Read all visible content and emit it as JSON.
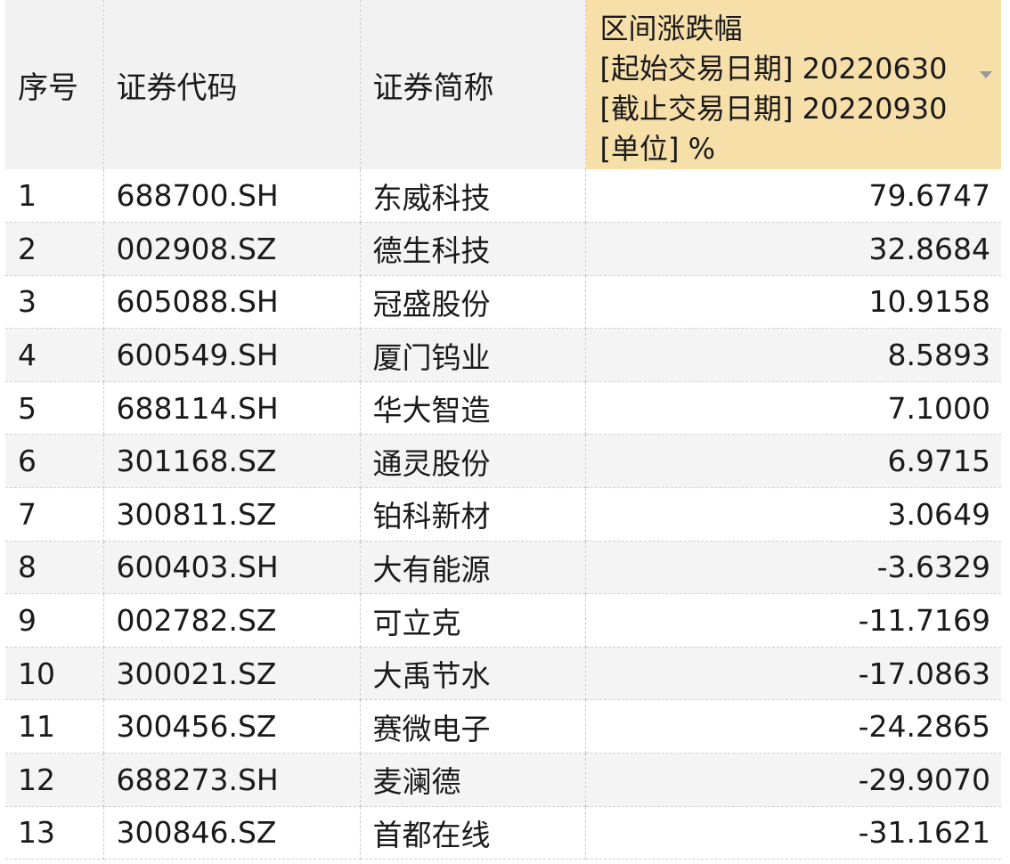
{
  "table": {
    "headers": {
      "seq": "序号",
      "code": "证券代码",
      "name": "证券简称",
      "change_lines": [
        "区间涨跌幅",
        "[起始交易日期] 20220630",
        "[截止交易日期] 20220930",
        "[单位] %"
      ]
    },
    "rows": [
      {
        "seq": "1",
        "code": "688700.SH",
        "name": "东威科技",
        "change": "79.6747"
      },
      {
        "seq": "2",
        "code": "002908.SZ",
        "name": "德生科技",
        "change": "32.8684"
      },
      {
        "seq": "3",
        "code": "605088.SH",
        "name": "冠盛股份",
        "change": "10.9158"
      },
      {
        "seq": "4",
        "code": "600549.SH",
        "name": "厦门钨业",
        "change": "8.5893"
      },
      {
        "seq": "5",
        "code": "688114.SH",
        "name": "华大智造",
        "change": "7.1000"
      },
      {
        "seq": "6",
        "code": "301168.SZ",
        "name": "通灵股份",
        "change": "6.9715"
      },
      {
        "seq": "7",
        "code": "300811.SZ",
        "name": "铂科新材",
        "change": "3.0649"
      },
      {
        "seq": "8",
        "code": "600403.SH",
        "name": "大有能源",
        "change": "-3.6329"
      },
      {
        "seq": "9",
        "code": "002782.SZ",
        "name": "可立克",
        "change": "-11.7169"
      },
      {
        "seq": "10",
        "code": "300021.SZ",
        "name": "大禹节水",
        "change": "-17.0863"
      },
      {
        "seq": "11",
        "code": "300456.SZ",
        "name": "赛微电子",
        "change": "-24.2865"
      },
      {
        "seq": "12",
        "code": "688273.SH",
        "name": "麦澜德",
        "change": "-29.9070"
      },
      {
        "seq": "13",
        "code": "300846.SZ",
        "name": "首都在线",
        "change": "-31.1621"
      }
    ],
    "sort": {
      "column": "change",
      "direction": "descending",
      "indicator_icon": "sort-down-triangle-icon"
    },
    "colors": {
      "header_bg": "#f2f2f2",
      "sorted_header_bg": "#f7dfaa",
      "stripe_bg": "#f4f4f4"
    }
  }
}
